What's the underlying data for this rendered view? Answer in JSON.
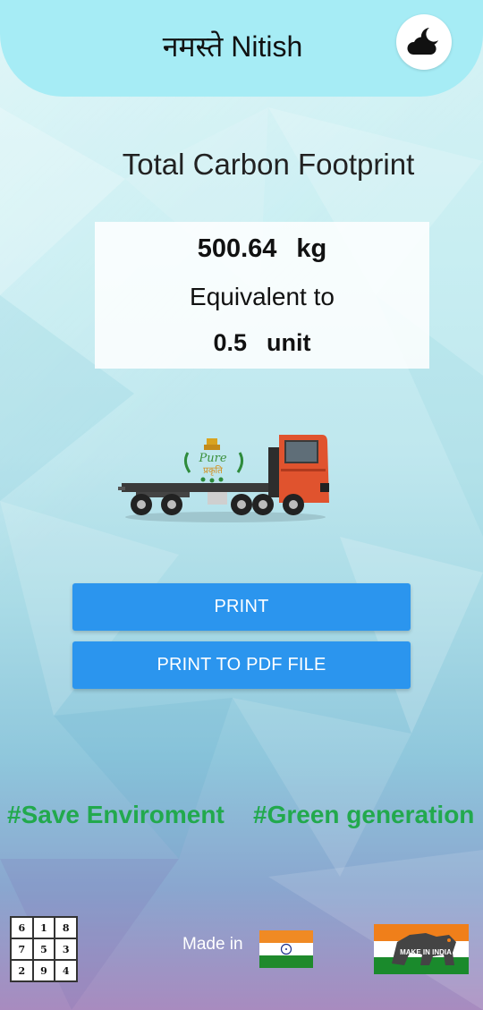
{
  "header": {
    "greeting": "नमस्ते  Nitish",
    "theme_icon": "cloud-moon-icon"
  },
  "main": {
    "title": "Total Carbon Footprint",
    "result": {
      "amount": "500.64",
      "amount_unit": "kg",
      "equivalent_label": "Equivalent to",
      "equivalent_value": "0.5",
      "equivalent_unit": "unit"
    },
    "logo_text": "Pure",
    "logo_text_hindi": "प्रकृति",
    "buttons": {
      "print": "PRINT",
      "print_pdf": "PRINT TO PDF FILE"
    }
  },
  "hashtags": [
    "#Save Enviroment",
    "#Green generation"
  ],
  "footer": {
    "grid_numbers": [
      "6",
      "1",
      "8",
      "7",
      "5",
      "3",
      "2",
      "9",
      "4"
    ],
    "made_in": "Made in",
    "make_in_india": "MAKE IN INDIA"
  },
  "colors": {
    "header_bg": "#a6ecf5",
    "button_bg": "#2b95ee",
    "hashtag_green": "#22a94d"
  }
}
